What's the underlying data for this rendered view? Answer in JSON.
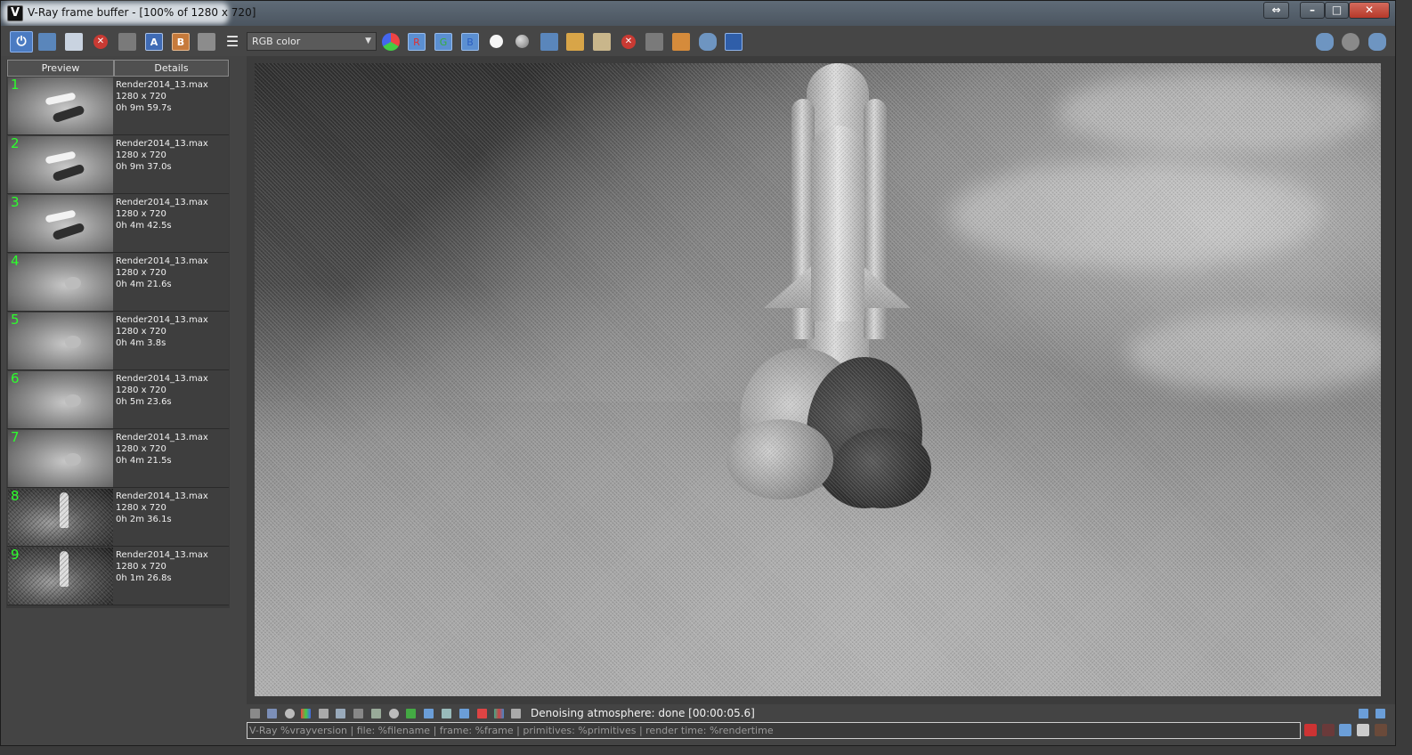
{
  "window": {
    "title": "V-Ray frame buffer - [100% of 1280 x 720]",
    "app_icon_glyph": "V",
    "buttons": {
      "swap": "⇔",
      "minimize": "–",
      "maximize": "□",
      "close": "✕"
    }
  },
  "toolbar": {
    "power_glyph": "⏻",
    "label_A": "A",
    "label_B": "B",
    "menu_glyph": "☰",
    "channel_select": {
      "value": "RGB color",
      "caret": "▼"
    },
    "channel_R": "R",
    "channel_G": "G",
    "channel_B": "B",
    "red_x_glyph": "✕"
  },
  "history": {
    "columns": [
      "Preview",
      "Details"
    ],
    "items": [
      {
        "num": "1",
        "file": "Render2014_13.max",
        "res": "1280 x 720",
        "time": "0h 9m 59.7s"
      },
      {
        "num": "2",
        "file": "Render2014_13.max",
        "res": "1280 x 720",
        "time": "0h 9m 37.0s"
      },
      {
        "num": "3",
        "file": "Render2014_13.max",
        "res": "1280 x 720",
        "time": "0h 4m 42.5s"
      },
      {
        "num": "4",
        "file": "Render2014_13.max",
        "res": "1280 x 720",
        "time": "0h 4m 21.6s"
      },
      {
        "num": "5",
        "file": "Render2014_13.max",
        "res": "1280 x 720",
        "time": "0h 4m 3.8s"
      },
      {
        "num": "6",
        "file": "Render2014_13.max",
        "res": "1280 x 720",
        "time": "0h 5m 23.6s"
      },
      {
        "num": "7",
        "file": "Render2014_13.max",
        "res": "1280 x 720",
        "time": "0h 4m 21.5s"
      },
      {
        "num": "8",
        "file": "Render2014_13.max",
        "res": "1280 x 720",
        "time": "0h 2m 36.1s"
      },
      {
        "num": "9",
        "file": "Render2014_13.max",
        "res": "1280 x 720",
        "time": "0h 1m 26.8s"
      }
    ]
  },
  "status": {
    "message": "Denoising atmosphere: done [00:00:05.6]",
    "stamp_text": "V-Ray %vrayversion | file: %filename | frame: %frame | primitives: %primitives | render time: %rendertime"
  },
  "colors": {
    "history_number": "#2cff2c",
    "accent_blue": "#4b7bc2"
  }
}
